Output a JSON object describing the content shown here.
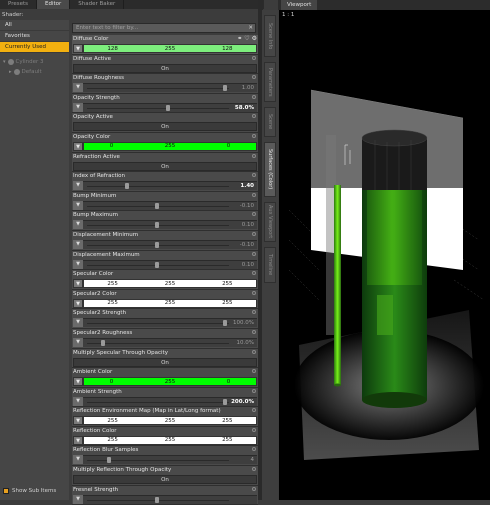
{
  "tabs": [
    "Presets",
    "Editor",
    "Shader Baker"
  ],
  "active_tab": "Editor",
  "shader_label": "Shader:",
  "categories": [
    {
      "label": "All",
      "selected": false
    },
    {
      "label": "Favorites",
      "selected": false
    },
    {
      "label": "Currently Used",
      "selected": true
    }
  ],
  "tree": [
    {
      "label": "Cylinder 3",
      "indent": false
    },
    {
      "label": "Default",
      "indent": true
    }
  ],
  "show_sub_items": "Show Sub Items",
  "search_placeholder": "Enter text to filter by...",
  "properties": [
    {
      "label": "Diffuse Color",
      "kind": "color",
      "bg": "#7dee7d",
      "values": [
        "128",
        "255",
        "128"
      ],
      "selected": true
    },
    {
      "label": "Diffuse Active",
      "kind": "toggle",
      "value": "On"
    },
    {
      "label": "Diffuse Roughness",
      "kind": "slider",
      "value": "1.00",
      "pos": 1.0
    },
    {
      "label": "Opacity Strength",
      "kind": "slider",
      "value": "58.0%",
      "pos": 0.58,
      "bright": true
    },
    {
      "label": "Opacity Active",
      "kind": "toggle",
      "value": "On"
    },
    {
      "label": "Opacity Color",
      "kind": "color",
      "bg": "#00ff00",
      "values": [
        "0",
        "255",
        "0"
      ]
    },
    {
      "label": "Refraction Active",
      "kind": "toggle",
      "value": "On"
    },
    {
      "label": "Index of Refraction",
      "kind": "slider",
      "value": "1.40",
      "pos": 0.28,
      "bright": true
    },
    {
      "label": "Bump Minimum",
      "kind": "slider",
      "value": "-0.10",
      "pos": 0.5
    },
    {
      "label": "Bump Maximum",
      "kind": "slider",
      "value": "0.10",
      "pos": 0.5
    },
    {
      "label": "Displacement Minimum",
      "kind": "slider",
      "value": "-0.10",
      "pos": 0.5
    },
    {
      "label": "Displacement Maximum",
      "kind": "slider",
      "value": "0.10",
      "pos": 0.5
    },
    {
      "label": "Specular Color",
      "kind": "color",
      "bg": "#ffffff",
      "values": [
        "255",
        "255",
        "255"
      ]
    },
    {
      "label": "Specular2 Color",
      "kind": "color",
      "bg": "#ffffff",
      "values": [
        "255",
        "255",
        "255"
      ]
    },
    {
      "label": "Specular2 Strength",
      "kind": "slider",
      "value": "100.0%",
      "pos": 1.0
    },
    {
      "label": "Specular2 Roughness",
      "kind": "slider",
      "value": "10.0%",
      "pos": 0.1
    },
    {
      "label": "Multiply Specular Through Opacity",
      "kind": "toggle",
      "value": "On"
    },
    {
      "label": "Ambient Color",
      "kind": "color",
      "bg": "#00ff00",
      "values": [
        "0",
        "255",
        "0"
      ]
    },
    {
      "label": "Ambient Strength",
      "kind": "slider",
      "value": "200.0%",
      "pos": 1.0,
      "bright": true
    },
    {
      "label": "Reflection Environment Map (Map in Lat/Long format)",
      "kind": "color",
      "bg": "#ffffff",
      "values": [
        "255",
        "255",
        "255"
      ]
    },
    {
      "label": "Reflection Color",
      "kind": "color",
      "bg": "#ffffff",
      "values": [
        "255",
        "255",
        "255"
      ]
    },
    {
      "label": "Reflection Blur Samples",
      "kind": "slider",
      "value": "4",
      "pos": 0.15
    },
    {
      "label": "Multiply Reflection Through Opacity",
      "kind": "toggle",
      "value": "On"
    },
    {
      "label": "Fresnel Strength",
      "kind": "slider",
      "value": "",
      "pos": 0.5
    }
  ],
  "vertical_tabs": [
    "Scene Info",
    "Parameters",
    "Scene",
    "Surfaces (Color)",
    "Aux Viewport",
    "Timeline"
  ],
  "active_vertical_tab": "Surfaces (Color)",
  "viewport_tab": "Viewport",
  "viewport_label": "1 : 1"
}
